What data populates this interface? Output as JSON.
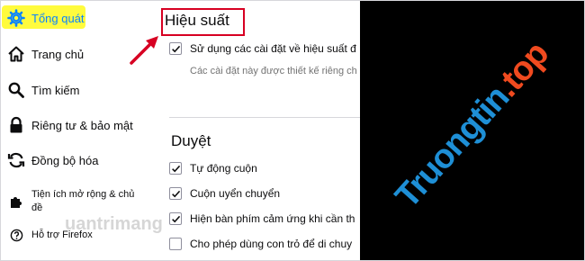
{
  "sidebar": {
    "items": [
      {
        "label": "Tổng quát",
        "icon": "gear-icon",
        "active": true
      },
      {
        "label": "Trang chủ",
        "icon": "home-icon"
      },
      {
        "label": "Tìm kiếm",
        "icon": "search-icon"
      },
      {
        "label": "Riêng tư & bảo mật",
        "icon": "lock-icon"
      },
      {
        "label": "Đồng bộ hóa",
        "icon": "sync-icon"
      },
      {
        "label": "Tiện ích mở rộng & chủ đề",
        "icon": "puzzle-icon"
      },
      {
        "label": "Hỗ trợ Firefox",
        "icon": "help-icon"
      }
    ]
  },
  "performance": {
    "title": "Hiệu suất",
    "recommended_label": "Sử dụng các cài đặt về hiệu suất đ",
    "recommended_desc": "Các cài đặt này được thiết kế riêng ch"
  },
  "browsing": {
    "title": "Duyệt",
    "options": [
      {
        "label": "Tự động cuộn",
        "checked": true
      },
      {
        "label": "Cuộn uyển chuyển",
        "checked": true
      },
      {
        "label": "Hiện bàn phím cảm ứng khi cần th",
        "checked": true
      },
      {
        "label": "Cho phép dùng con trỏ để di chuy",
        "checked": false
      }
    ]
  },
  "watermark": {
    "main": "Truongtin",
    "tld": ".top",
    "secondary": "uantrimang"
  },
  "colors": {
    "accent": "#0a84ff",
    "highlight": "#fffb3d",
    "annotation_red": "#d70022"
  }
}
